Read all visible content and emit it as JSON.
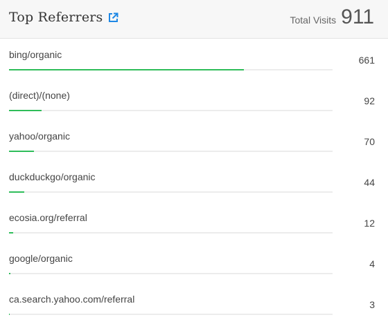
{
  "widget": {
    "title": "Top Referrers",
    "total_label": "Total Visits",
    "total_value": "911",
    "accent_color": "#2ebd59",
    "title_icon": "external-link-icon"
  },
  "referrers": [
    {
      "label": "bing/organic",
      "value": "661",
      "share": 0.726
    },
    {
      "label": "(direct)/(none)",
      "value": "92",
      "share": 0.101
    },
    {
      "label": "yahoo/organic",
      "value": "70",
      "share": 0.077
    },
    {
      "label": "duckduckgo/organic",
      "value": "44",
      "share": 0.048
    },
    {
      "label": "ecosia.org/referral",
      "value": "12",
      "share": 0.013
    },
    {
      "label": "google/organic",
      "value": "4",
      "share": 0.004
    },
    {
      "label": "ca.search.yahoo.com/referral",
      "value": "3",
      "share": 0.003
    }
  ]
}
